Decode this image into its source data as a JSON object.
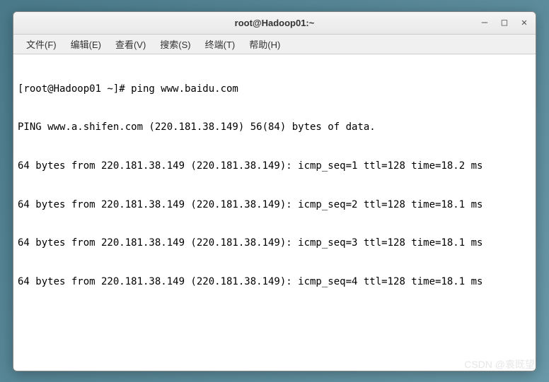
{
  "window": {
    "title": "root@Hadoop01:~"
  },
  "menu": {
    "file": "文件(F)",
    "edit": "编辑(E)",
    "view": "查看(V)",
    "search": "搜索(S)",
    "terminal": "终端(T)",
    "help": "帮助(H)"
  },
  "terminal": {
    "line1": "[root@Hadoop01 ~]# ping www.baidu.com",
    "line2": "PING www.a.shifen.com (220.181.38.149) 56(84) bytes of data.",
    "line3": "64 bytes from 220.181.38.149 (220.181.38.149): icmp_seq=1 ttl=128 time=18.2 ms",
    "line4": "64 bytes from 220.181.38.149 (220.181.38.149): icmp_seq=2 ttl=128 time=18.1 ms",
    "line5": "64 bytes from 220.181.38.149 (220.181.38.149): icmp_seq=3 ttl=128 time=18.1 ms",
    "line6": "64 bytes from 220.181.38.149 (220.181.38.149): icmp_seq=4 ttl=128 time=18.1 ms"
  },
  "watermark": "CSDN @袁既望"
}
